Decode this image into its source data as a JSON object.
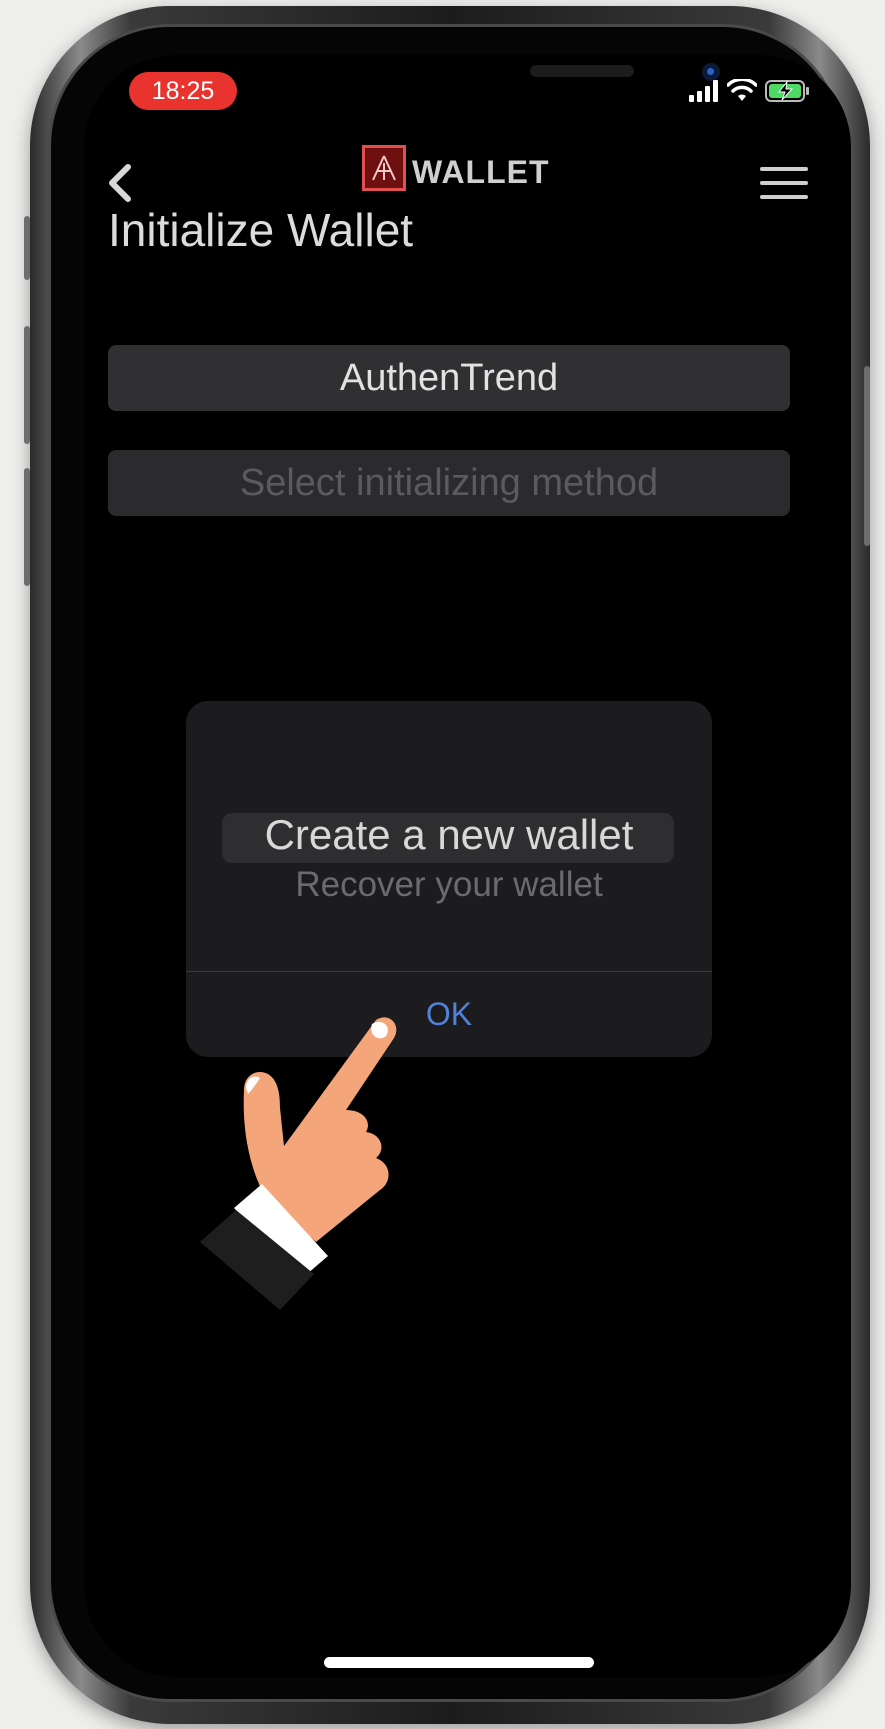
{
  "status_bar": {
    "time": "18:25",
    "icons": [
      "cellular-signal-icon",
      "wifi-icon",
      "battery-charging-icon"
    ]
  },
  "nav": {
    "back_icon": "chevron-left-icon",
    "logo_letter": "A",
    "logo_text": "WALLET",
    "menu_icon": "hamburger-menu-icon"
  },
  "page": {
    "title": "Initialize Wallet",
    "device_field": "AuthenTrend",
    "method_placeholder": "Select initializing method"
  },
  "dialog": {
    "options": [
      "Create a new wallet",
      "Recover your wallet"
    ],
    "selected_option": "Create a new wallet",
    "ok_label": "OK"
  },
  "overlay": {
    "pointer_icon": "pointing-hand-icon"
  },
  "colors": {
    "time_pill": "#e8332e",
    "ok_text": "#4f82d8",
    "logo_accent": "#e05050"
  }
}
